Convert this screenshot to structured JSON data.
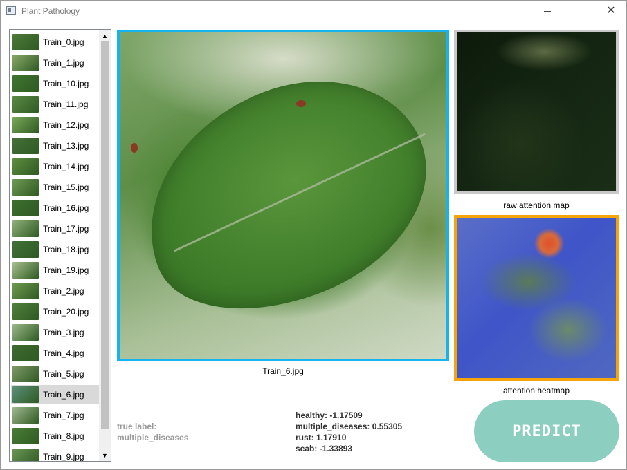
{
  "window": {
    "title": "Plant Pathology",
    "controls": {
      "minimize_icon": "minimize-icon",
      "maximize_icon": "maximize-icon",
      "close_icon": "close-icon"
    }
  },
  "file_list": {
    "items": [
      {
        "label": "Train_0.jpg",
        "thumb_color": "#4d7a3a"
      },
      {
        "label": "Train_1.jpg",
        "thumb_color": "#8aa86a"
      },
      {
        "label": "Train_10.jpg",
        "thumb_color": "#3f7530"
      },
      {
        "label": "Train_11.jpg",
        "thumb_color": "#5a8a45"
      },
      {
        "label": "Train_12.jpg",
        "thumb_color": "#7aa85a"
      },
      {
        "label": "Train_13.jpg",
        "thumb_color": "#466f3a"
      },
      {
        "label": "Train_14.jpg",
        "thumb_color": "#5e8e40"
      },
      {
        "label": "Train_15.jpg",
        "thumb_color": "#6f9a55"
      },
      {
        "label": "Train_16.jpg",
        "thumb_color": "#3e6f2f"
      },
      {
        "label": "Train_17.jpg",
        "thumb_color": "#8fb07a"
      },
      {
        "label": "Train_18.jpg",
        "thumb_color": "#42703a"
      },
      {
        "label": "Train_19.jpg",
        "thumb_color": "#a7bf8f"
      },
      {
        "label": "Train_2.jpg",
        "thumb_color": "#6e9a50"
      },
      {
        "label": "Train_20.jpg",
        "thumb_color": "#4f7f3d"
      },
      {
        "label": "Train_3.jpg",
        "thumb_color": "#9ab88a"
      },
      {
        "label": "Train_4.jpg",
        "thumb_color": "#3d6a32"
      },
      {
        "label": "Train_5.jpg",
        "thumb_color": "#7f9a6a"
      },
      {
        "label": "Train_6.jpg",
        "thumb_color": "#5a8f7a"
      },
      {
        "label": "Train_7.jpg",
        "thumb_color": "#a0b890"
      },
      {
        "label": "Train_8.jpg",
        "thumb_color": "#4a7d38"
      },
      {
        "label": "Train_9.jpg",
        "thumb_color": "#6b9656"
      }
    ],
    "selected_label": "Train_6.jpg",
    "scroll_up_icon": "scroll-up-arrow-icon",
    "scroll_down_icon": "scroll-down-arrow-icon"
  },
  "main_image": {
    "caption": "Train_6.jpg",
    "border_color": "#15b4ef"
  },
  "raw_attention": {
    "caption": "raw attention map",
    "border_color": "#c9c9c9"
  },
  "attention_heatmap": {
    "caption": "attention heatmap",
    "border_color": "#f5a50a"
  },
  "true_label": {
    "heading": "true label:",
    "value": "multiple_diseases"
  },
  "scores": [
    {
      "text": "healthy: -1.17509"
    },
    {
      "text": "multiple_diseases: 0.55305"
    },
    {
      "text": "rust: 1.17910"
    },
    {
      "text": "scab: -1.33893"
    }
  ],
  "predict_button": {
    "label": "PREDICT",
    "color": "#8ccfc1"
  }
}
